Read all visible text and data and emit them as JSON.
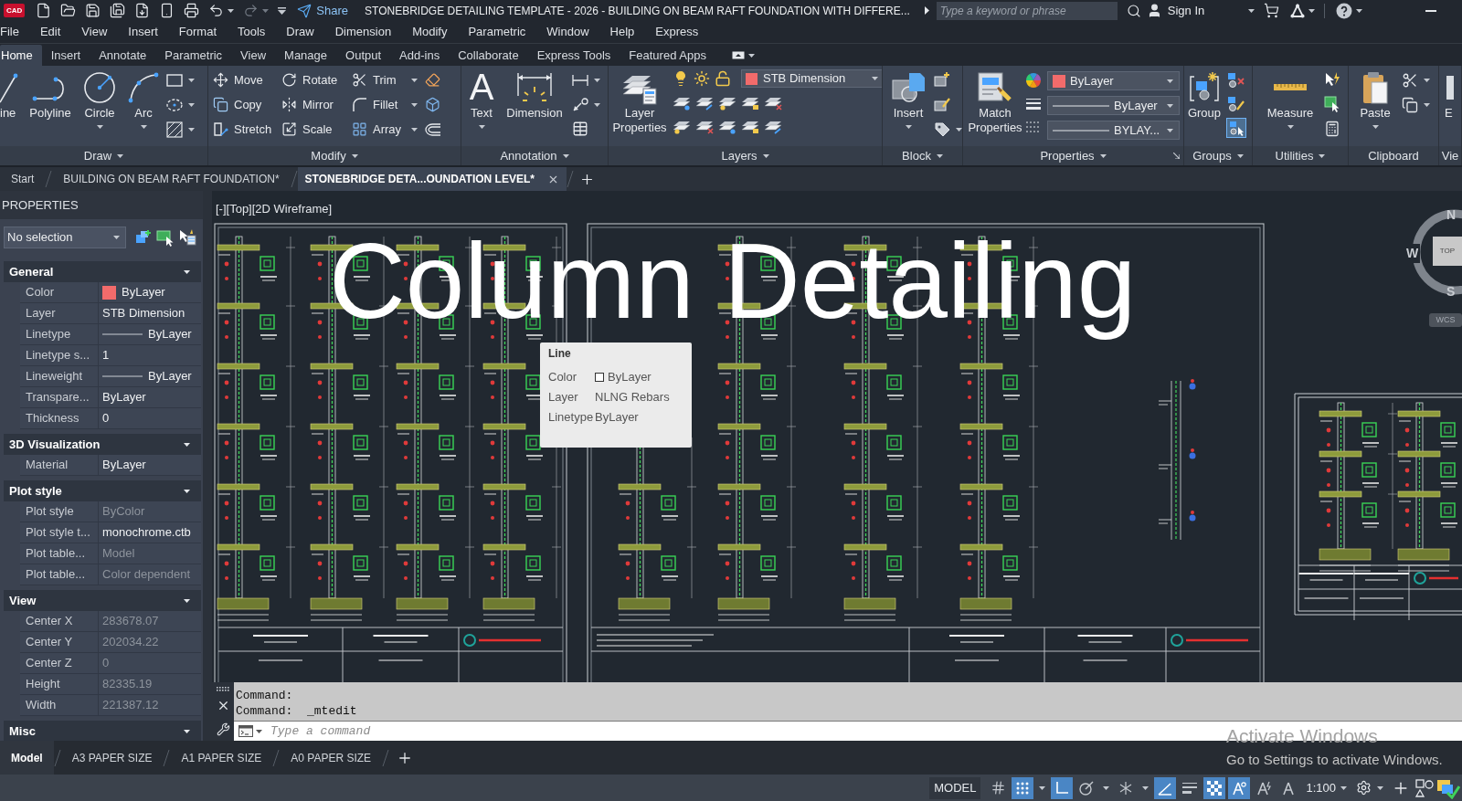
{
  "title_bar": {
    "logo": "CAD",
    "share": "Share",
    "title": "STONEBRIDGE DETAILING TEMPLATE - 2026 - BUILDING ON BEAM RAFT FOUNDATION WITH DIFFERE...",
    "search": {
      "placeholder": "Type a keyword or phrase"
    },
    "sign_in": "Sign In"
  },
  "menu_bar": [
    "File",
    "Edit",
    "View",
    "Insert",
    "Format",
    "Tools",
    "Draw",
    "Dimension",
    "Modify",
    "Parametric",
    "Window",
    "Help",
    "Express"
  ],
  "ribbon_tabs": [
    {
      "label": "Home",
      "selected": true
    },
    {
      "label": "Insert",
      "selected": false
    },
    {
      "label": "Annotate",
      "selected": false
    },
    {
      "label": "Parametric",
      "selected": false
    },
    {
      "label": "View",
      "selected": false
    },
    {
      "label": "Manage",
      "selected": false
    },
    {
      "label": "Output",
      "selected": false
    },
    {
      "label": "Add-ins",
      "selected": false
    },
    {
      "label": "Collaborate",
      "selected": false
    },
    {
      "label": "Express Tools",
      "selected": false
    },
    {
      "label": "Featured Apps",
      "selected": false
    }
  ],
  "ribbon_panels": [
    {
      "kind": "draw",
      "label": "Draw",
      "menu": true,
      "tools": [
        "ine",
        "Polyline",
        "Circle",
        "Arc"
      ]
    },
    {
      "kind": "modify",
      "label": "Modify",
      "menu": true,
      "tools": [
        "Move",
        "Rotate",
        "Trim",
        "Copy",
        "Mirror",
        "Fillet",
        "Stretch",
        "Scale",
        "Array"
      ]
    },
    {
      "kind": "annotation",
      "label": "Annotation",
      "menu": true,
      "glyph": "A",
      "tools": [
        "Text",
        "Dimension"
      ]
    },
    {
      "kind": "layers",
      "label": "Layers",
      "menu": true,
      "tools": [
        "Layer Properties"
      ],
      "layer": {
        "value": "STB Dimension",
        "color": "#f26b6b"
      }
    },
    {
      "kind": "block",
      "label": "Block",
      "menu": true,
      "tools": [
        "Insert"
      ]
    },
    {
      "kind": "properties",
      "label": "Properties",
      "menu": true,
      "tools": [
        "Match Properties"
      ],
      "color": {
        "value": "ByLayer",
        "color": "#f26b6b"
      },
      "lineweight": "ByLayer",
      "linetype": "BYLAY..."
    },
    {
      "kind": "groups",
      "label": "Groups",
      "menu": true,
      "tools": [
        "Group"
      ],
      "selection_on": true
    },
    {
      "kind": "utilities",
      "label": "Utilities",
      "menu": true,
      "tools": [
        "Measure"
      ]
    },
    {
      "kind": "clipboard",
      "label": "Clipboard",
      "menu": false,
      "tools": [
        "Paste"
      ]
    },
    {
      "kind": "view",
      "label": "Vie",
      "menu": false,
      "tools": [
        "E"
      ]
    }
  ],
  "document_tabs": [
    {
      "label": "Start",
      "selected": false
    },
    {
      "label": "BUILDING ON BEAM RAFT FOUNDATION*",
      "selected": false
    },
    {
      "label": "STONEBRIDGE DETA...OUNDATION LEVEL*",
      "selected": true
    }
  ],
  "properties_palette": {
    "title": "PROPERTIES",
    "selection": "No selection",
    "sections": [
      {
        "title": "General",
        "rows": [
          {
            "label": "Color",
            "value": "ByLayer",
            "kind": "swatch",
            "color": "#f26b6b",
            "disabled": false
          },
          {
            "label": "Layer",
            "value": "STB Dimension",
            "kind": "text",
            "disabled": false
          },
          {
            "label": "Linetype",
            "value": "ByLayer",
            "kind": "line",
            "disabled": false
          },
          {
            "label": "Linetype s...",
            "value": "1",
            "kind": "text",
            "disabled": false
          },
          {
            "label": "Lineweight",
            "value": "ByLayer",
            "kind": "line",
            "disabled": false
          },
          {
            "label": "Transpare...",
            "value": "ByLayer",
            "kind": "text",
            "disabled": false
          },
          {
            "label": "Thickness",
            "value": "0",
            "kind": "text",
            "disabled": false
          }
        ]
      },
      {
        "title": "3D Visualization",
        "rows": [
          {
            "label": "Material",
            "value": "ByLayer",
            "kind": "text",
            "disabled": false
          }
        ]
      },
      {
        "title": "Plot style",
        "rows": [
          {
            "label": "Plot style",
            "value": "ByColor",
            "kind": "text",
            "disabled": true
          },
          {
            "label": "Plot style t...",
            "value": "monochrome.ctb",
            "kind": "text",
            "disabled": false
          },
          {
            "label": "Plot table...",
            "value": "Model",
            "kind": "text",
            "disabled": true
          },
          {
            "label": "Plot table...",
            "value": "Color dependent",
            "kind": "text",
            "disabled": true
          }
        ]
      },
      {
        "title": "View",
        "rows": [
          {
            "label": "Center X",
            "value": "283678.07",
            "kind": "text",
            "disabled": true
          },
          {
            "label": "Center Y",
            "value": "202034.22",
            "kind": "text",
            "disabled": true
          },
          {
            "label": "Center Z",
            "value": "0",
            "kind": "text",
            "disabled": true
          },
          {
            "label": "Height",
            "value": "82335.19",
            "kind": "text",
            "disabled": true
          },
          {
            "label": "Width",
            "value": "221387.12",
            "kind": "text",
            "disabled": true
          }
        ]
      },
      {
        "title": "Misc"
      }
    ]
  },
  "viewport": {
    "label": "[-][Top][2D Wireframe]",
    "caption": "Column Detailing",
    "tooltip": {
      "title": "Line",
      "rows": [
        {
          "label": "Color",
          "value": "ByLayer",
          "swatch": true
        },
        {
          "label": "Layer",
          "value": "NLNG Rebars",
          "swatch": false
        },
        {
          "label": "Linetype",
          "value": "ByLayer",
          "swatch": false
        }
      ]
    },
    "viewcube": {
      "north": "N",
      "west": "W",
      "south": "S",
      "face": "TOP",
      "ucs": "WCS"
    }
  },
  "command_line": {
    "history": [
      "Command:",
      "Command:  _mtedit"
    ],
    "placeholder": "Type a command"
  },
  "layout_tabs": [
    {
      "label": "Model",
      "selected": true
    },
    {
      "label": "A3 PAPER SIZE",
      "selected": false
    },
    {
      "label": "A1 PAPER SIZE",
      "selected": false
    },
    {
      "label": "A0 PAPER SIZE",
      "selected": false
    }
  ],
  "status_bar": {
    "space": "MODEL",
    "toggles": [
      {
        "on": false
      },
      {
        "on": true
      },
      {
        "on": true
      },
      {
        "on": false
      },
      {
        "on": false
      },
      {
        "on": true
      },
      {
        "on": false
      },
      {
        "on": true
      },
      {
        "on": true
      },
      {
        "on": false
      },
      {
        "on": false
      }
    ],
    "scale": "1:100"
  },
  "windows_notice": {
    "title": "Activate Windows",
    "body": "Go to Settings to activate Windows."
  }
}
